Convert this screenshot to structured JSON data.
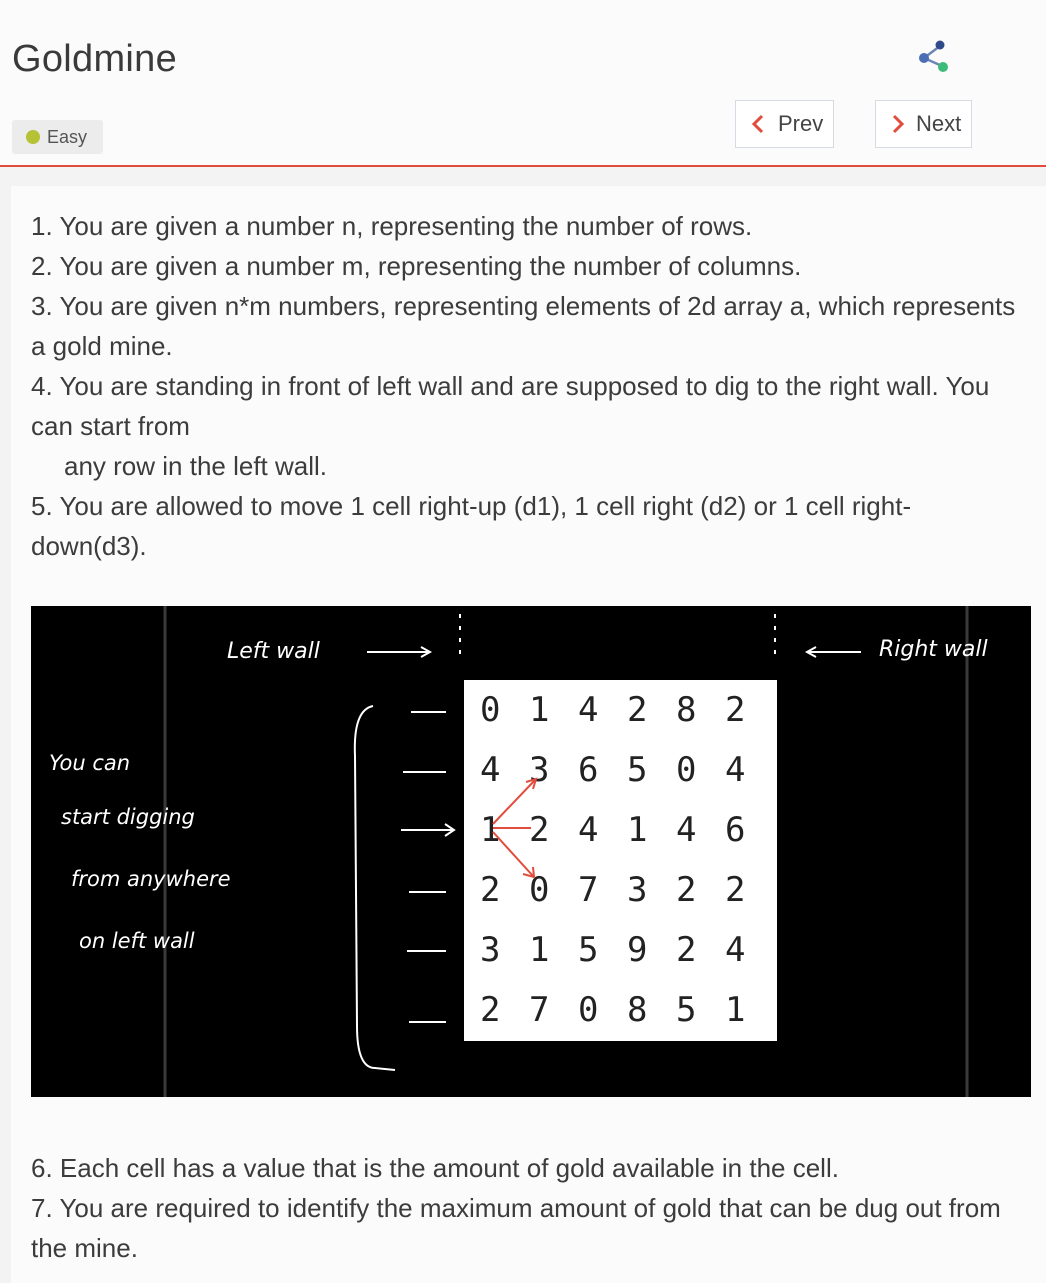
{
  "header": {
    "title": "Goldmine",
    "difficulty": "Easy",
    "difficulty_color": "#b5c235",
    "share_icon": "share-icon",
    "prev_label": "Prev",
    "next_label": "Next",
    "accent_color": "#e24c3c"
  },
  "problem": {
    "lines": [
      "1. You are given a number n, representing the number of rows.",
      "2. You are given a number m, representing the number of columns.",
      "3. You are given n*m numbers, representing elements of 2d array a, which represents a gold mine.",
      "4. You are standing in front of left wall and are supposed to dig to the right wall. You can start from",
      "any row in the left wall.",
      "5. You are allowed to move 1 cell right-up (d1), 1 cell right (d2) or 1 cell right-down(d3)."
    ],
    "lines_after": [
      "6. Each cell has a value that is the amount of gold available in the cell.",
      "7. You are required to identify the maximum amount of gold that can be dug out from the mine."
    ]
  },
  "figure": {
    "left_wall_label": "Left wall",
    "right_wall_label": "Right wall",
    "note_lines": [
      "You  can",
      "start digging",
      "from anywhere",
      "on  left wall"
    ],
    "grid": [
      [
        "0",
        "1",
        "4",
        "2",
        "8",
        "2"
      ],
      [
        "4",
        "3",
        "6",
        "5",
        "0",
        "4"
      ],
      [
        "1",
        "2",
        "4",
        "1",
        "4",
        "6"
      ],
      [
        "2",
        "0",
        "7",
        "3",
        "2",
        "2"
      ],
      [
        "3",
        "1",
        "5",
        "9",
        "2",
        "4"
      ],
      [
        "2",
        "7",
        "0",
        "8",
        "5",
        "1"
      ]
    ]
  }
}
